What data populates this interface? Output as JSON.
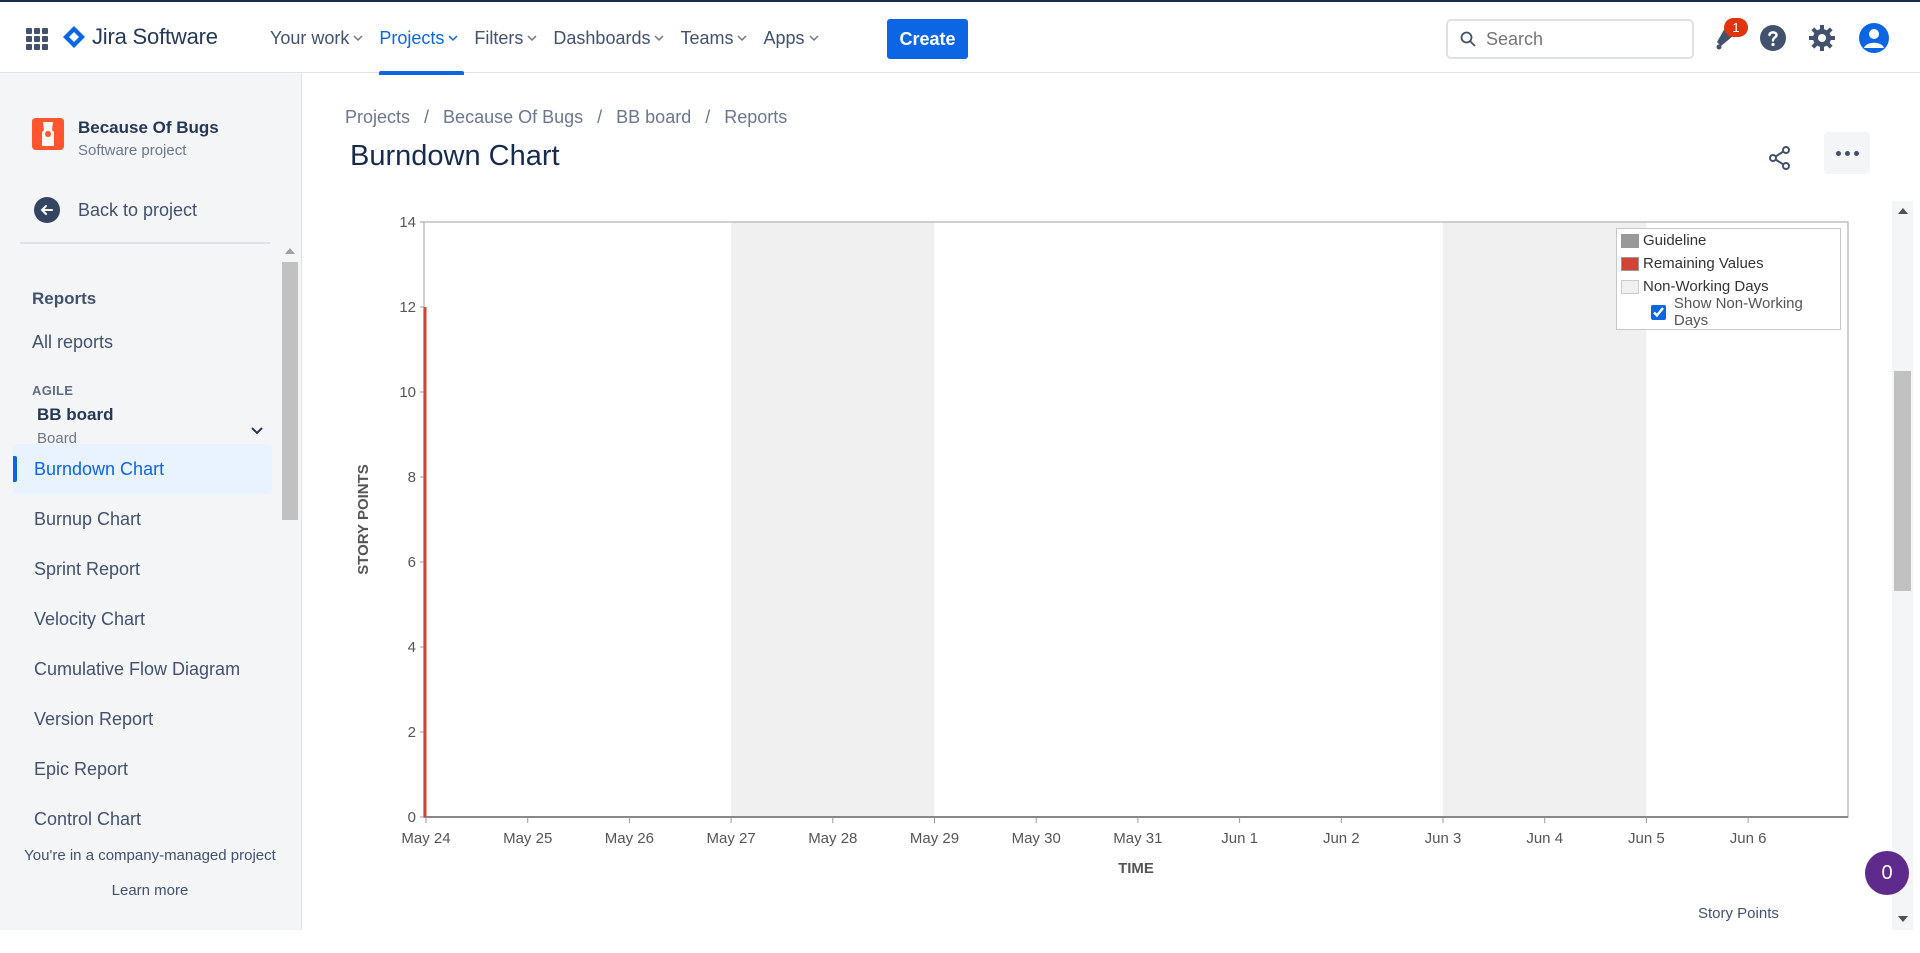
{
  "topnav": {
    "logo_text": "Jira Software",
    "items": [
      {
        "label": "Your work",
        "active": false
      },
      {
        "label": "Projects",
        "active": true
      },
      {
        "label": "Filters",
        "active": false
      },
      {
        "label": "Dashboards",
        "active": false
      },
      {
        "label": "Teams",
        "active": false
      },
      {
        "label": "Apps",
        "active": false
      }
    ],
    "create_label": "Create",
    "search_placeholder": "Search",
    "notification_count": "1",
    "icons": [
      "apps-grid-icon",
      "jira-logo-icon",
      "search-icon",
      "notification-icon",
      "help-icon",
      "settings-icon",
      "profile-icon"
    ]
  },
  "sidebar": {
    "project_name": "Because Of Bugs",
    "project_type": "Software project",
    "back_label": "Back to project",
    "reports_title": "Reports",
    "all_reports": "All reports",
    "agile_label": "AGILE",
    "board_name": "BB board",
    "board_type": "Board",
    "items": [
      {
        "label": "Burndown Chart",
        "active": true
      },
      {
        "label": "Burnup Chart",
        "active": false
      },
      {
        "label": "Sprint Report",
        "active": false
      },
      {
        "label": "Velocity Chart",
        "active": false
      },
      {
        "label": "Cumulative Flow Diagram",
        "active": false
      },
      {
        "label": "Version Report",
        "active": false
      },
      {
        "label": "Epic Report",
        "active": false
      },
      {
        "label": "Control Chart",
        "active": false
      }
    ],
    "footer_message": "You're in a company-managed project",
    "learn_more": "Learn more"
  },
  "main": {
    "breadcrumb": [
      "Projects",
      "Because Of Bugs",
      "BB board",
      "Reports"
    ],
    "title": "Burndown Chart",
    "story_points_label": "Story Points",
    "chat_count": "0"
  },
  "legend": {
    "guideline": "Guideline",
    "remaining": "Remaining Values",
    "non_working": "Non-Working Days",
    "show_non_working": "Show Non-Working Days",
    "show_non_working_checked": true
  },
  "chart_data": {
    "type": "line",
    "xlabel": "TIME",
    "ylabel": "STORY POINTS",
    "ylim": [
      0,
      14
    ],
    "yticks": [
      0,
      2,
      4,
      6,
      8,
      10,
      12,
      14
    ],
    "xticks": [
      "May 24",
      "May 25",
      "May 26",
      "May 27",
      "May 28",
      "May 29",
      "May 30",
      "May 31",
      "Jun 1",
      "Jun 2",
      "Jun 3",
      "Jun 4",
      "Jun 5",
      "Jun 6"
    ],
    "non_working_ranges": [
      [
        "May 27",
        "May 29"
      ],
      [
        "Jun 3",
        "Jun 5"
      ]
    ],
    "series": [
      {
        "name": "Remaining Values",
        "color": "#d04437",
        "points": [
          {
            "x": "May 24",
            "y": 12
          },
          {
            "x": "May 24",
            "y": 0
          }
        ]
      }
    ],
    "colors": {
      "guideline": "#999999",
      "remaining": "#d04437",
      "non_working": "#f0f0f0"
    }
  }
}
